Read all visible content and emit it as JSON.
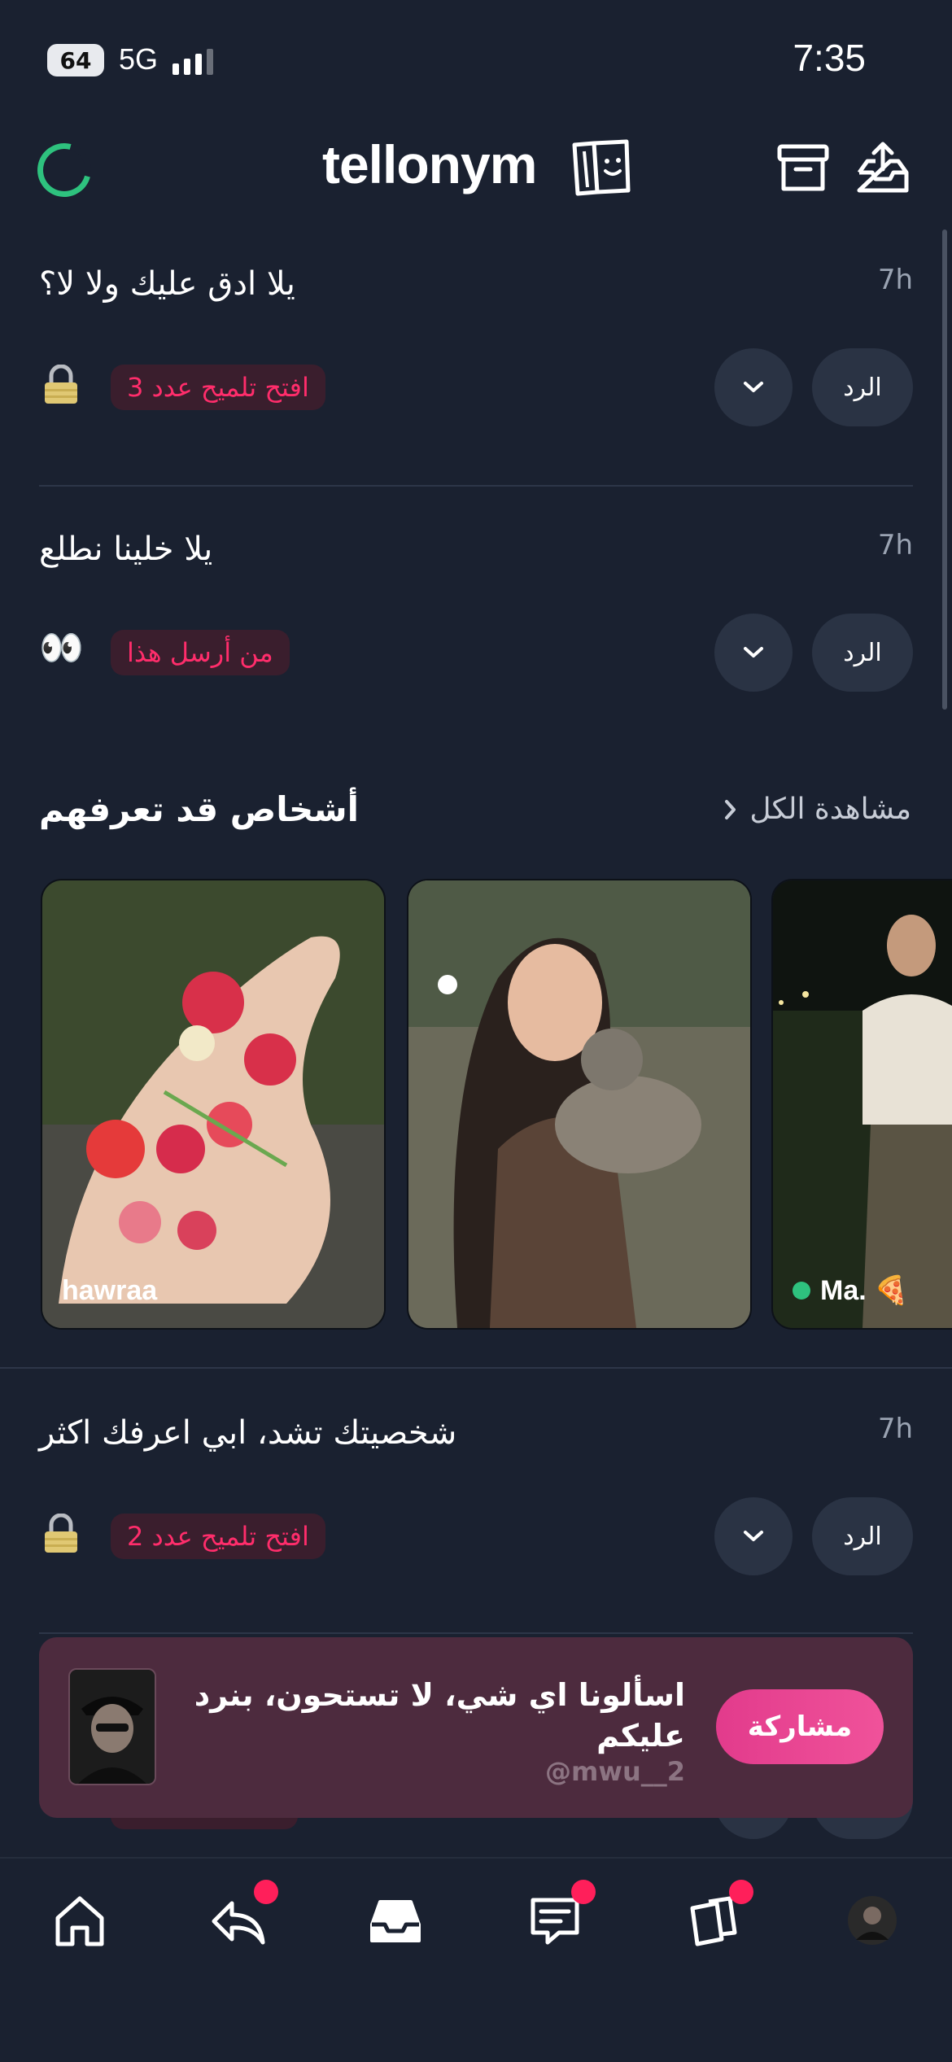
{
  "status_bar": {
    "battery": "64",
    "network": "5G",
    "time": "7:35"
  },
  "header": {
    "brand": "tellonym",
    "icons": [
      "loading-icon",
      "tellonym-logo-icon",
      "archive-icon",
      "share-inbox-icon"
    ]
  },
  "questions": [
    {
      "time": "7h",
      "text": "يلا ادق عليك ولا لا؟",
      "hint": "افتح تلميح عدد 3",
      "marker": "lock-icon",
      "reply_label": "الرد"
    },
    {
      "time": "7h",
      "text": "يلا خلينا نطلع",
      "hint": "من أرسل هذا",
      "marker": "👀",
      "reply_label": "الرد"
    },
    {
      "time": "7h",
      "text": "شخصيتك تشد، ابي اعرفك اكثر",
      "hint": "افتح تلميح عدد 2",
      "marker": "lock-icon",
      "reply_label": "الرد"
    }
  ],
  "suggestions": {
    "title": "أشخاص قد تعرفهم",
    "see_all": "مشاهدة الكل",
    "people": [
      {
        "name": "hawraa",
        "online": false
      },
      {
        "name": "",
        "online": false
      },
      {
        "name": "Ma. 🍕",
        "online": true
      }
    ]
  },
  "promo": {
    "text": "اسألونا اي شي، لا تستحون، بنرد عليكم",
    "handle": "@mwu__2",
    "button": "مشاركة"
  },
  "tabs": [
    {
      "icon": "home-icon",
      "badge": false
    },
    {
      "icon": "reply-icon",
      "badge": true
    },
    {
      "icon": "inbox-icon",
      "badge": false
    },
    {
      "icon": "messages-icon",
      "badge": true
    },
    {
      "icon": "cards-icon",
      "badge": true
    },
    {
      "icon": "profile-avatar",
      "badge": false
    }
  ],
  "colors": {
    "background": "#1a2130",
    "accent_pink": "#ff2d6b",
    "online_green": "#2ec27e",
    "promo_bg": "#4d2b3e"
  }
}
